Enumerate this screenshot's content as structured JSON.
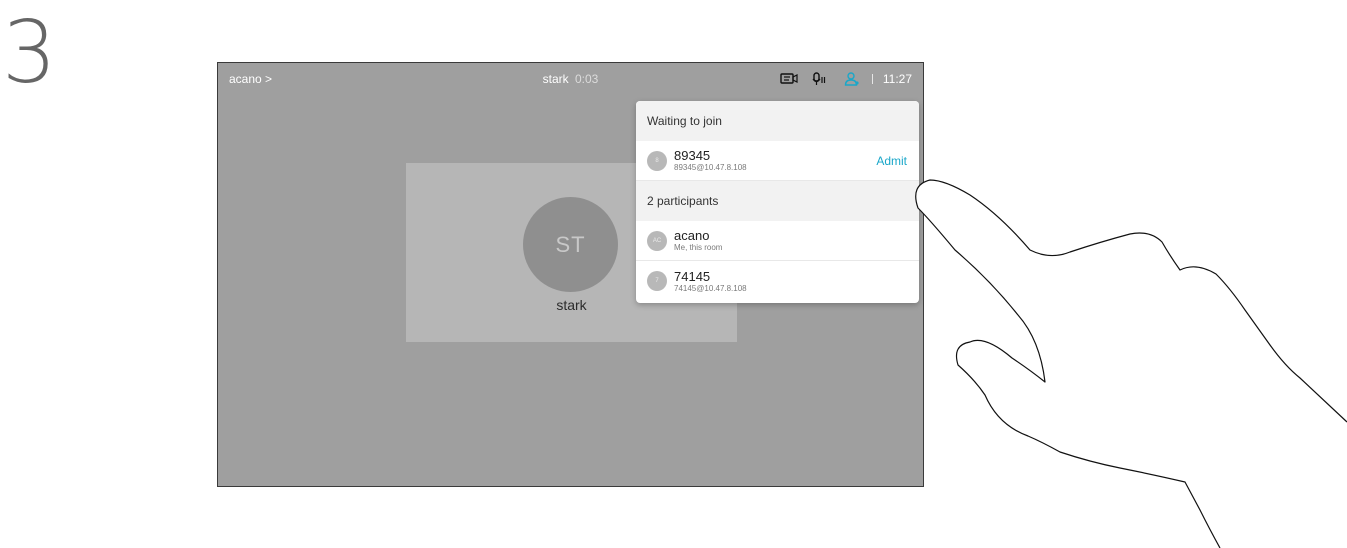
{
  "step": {
    "number": "3"
  },
  "topbar": {
    "breadcrumb": "acano >",
    "call_name": "stark",
    "call_time": "0:03",
    "clock": "11:27",
    "icons": [
      "share-screen-icon",
      "mic-icon",
      "participants-icon"
    ]
  },
  "self_view": {
    "initials": "ST",
    "name": "stark"
  },
  "panel": {
    "waiting_header": "Waiting to join",
    "waiting": [
      {
        "initial": "8",
        "name": "89345",
        "address": "89345@10.47.8.108",
        "action": "Admit"
      }
    ],
    "participants_header": "2 participants",
    "participants": [
      {
        "initial": "AC",
        "name": "acano",
        "address": "Me, this room"
      },
      {
        "initial": "7",
        "name": "74145",
        "address": "74145@10.47.8.108"
      }
    ]
  },
  "colors": {
    "screen_bg": "#9f9f9f",
    "accent": "#1aa7c9",
    "panel_bg": "#ffffff"
  }
}
